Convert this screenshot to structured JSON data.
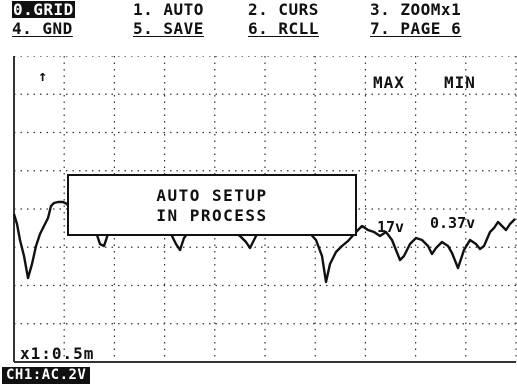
{
  "menu": {
    "items": [
      {
        "label": "0.GRID",
        "selected": true
      },
      {
        "label": "1. AUTO"
      },
      {
        "label": "2. CURS"
      },
      {
        "label": "3. ZOOMx1"
      },
      {
        "label": "4. GND"
      },
      {
        "label": "5. SAVE"
      },
      {
        "label": "6. RCLL"
      },
      {
        "label": "7. PAGE  6"
      }
    ]
  },
  "screen": {
    "trigger_marker": "↑",
    "max_label": "MAX",
    "min_label": "MIN",
    "readout_1": "17v",
    "readout_2": "0.37v",
    "timebase": "x1:0.5m"
  },
  "dialog": {
    "line1": "AUTO SETUP",
    "line2": "IN PROCESS"
  },
  "status": {
    "channel": "CH1:AC.2V"
  },
  "colors": {
    "ink": "#111111",
    "background": "#ffffff"
  }
}
